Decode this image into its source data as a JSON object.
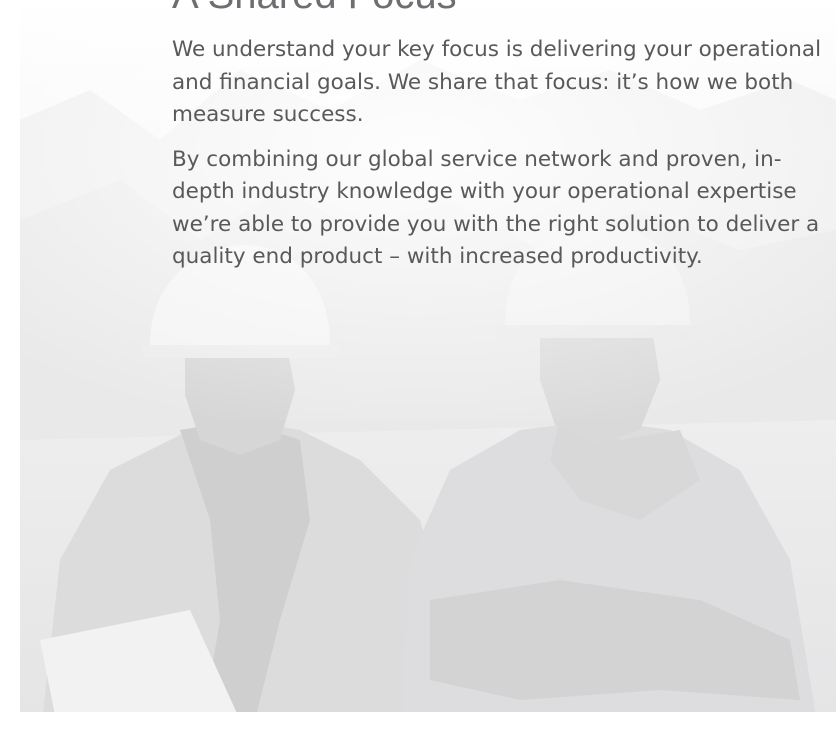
{
  "document": {
    "heading": "A Shared Focus",
    "paragraphs": [
      "We understand your key focus is delivering your operational and financial goals. We share that focus: it’s how we both measure success.",
      "By combining our global service network and proven, in-depth industry knowledge with your operational expertise we’re able to provide you with the right solution to deliver a quality end product – with increased productivity."
    ]
  },
  "colors": {
    "heading_text": "#6d6e71",
    "body_text": "#58595b",
    "photo_tint": "#e6e6e7"
  },
  "icons": {
    "background_photo": "two-workers-hard-hats-photo"
  }
}
